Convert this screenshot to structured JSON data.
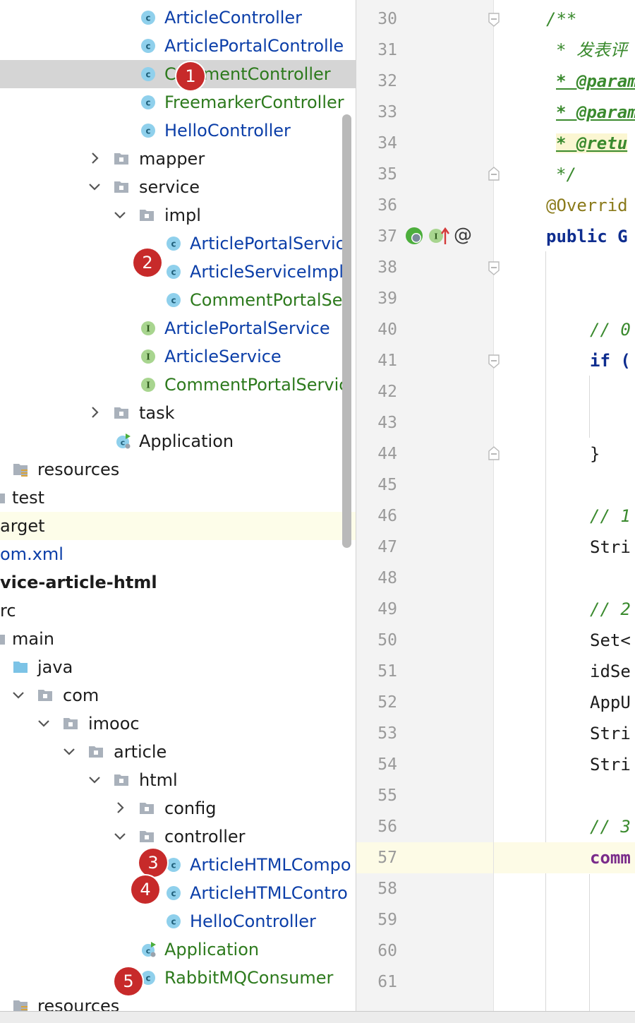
{
  "project_tree": {
    "items": [
      {
        "label": "ArticleController",
        "icon": "class-icon",
        "color": "blue"
      },
      {
        "label": "ArticlePortalControlle",
        "icon": "class-icon",
        "color": "blue"
      },
      {
        "label": "CommentController",
        "icon": "class-icon",
        "color": "green",
        "selected": true
      },
      {
        "label": "FreemarkerController",
        "icon": "class-icon",
        "color": "green"
      },
      {
        "label": "HelloController",
        "icon": "class-icon",
        "color": "blue"
      },
      {
        "label": "mapper",
        "icon": "folder-icon",
        "expanded": false
      },
      {
        "label": "service",
        "icon": "folder-icon",
        "expanded": true
      },
      {
        "label": "impl",
        "icon": "folder-icon",
        "expanded": true
      },
      {
        "label": "ArticlePortalServic",
        "icon": "class-icon",
        "color": "blue"
      },
      {
        "label": "ArticleServiceImpl",
        "icon": "class-icon",
        "color": "blue"
      },
      {
        "label": "CommentPortalSer",
        "icon": "class-icon",
        "color": "green"
      },
      {
        "label": "ArticlePortalService",
        "icon": "interface-icon",
        "color": "blue"
      },
      {
        "label": "ArticleService",
        "icon": "interface-icon",
        "color": "blue"
      },
      {
        "label": "CommentPortalServic",
        "icon": "interface-icon",
        "color": "green"
      },
      {
        "label": "task",
        "icon": "folder-icon",
        "expanded": false
      },
      {
        "label": "Application",
        "icon": "spring-app-icon",
        "color": "black"
      },
      {
        "label": "resources",
        "icon": "resources-folder-icon"
      },
      {
        "label": "test",
        "icon": "folder-icon"
      },
      {
        "label": "arget",
        "icon": "none"
      },
      {
        "label": "om.xml",
        "icon": "none",
        "color": "blue"
      },
      {
        "label": "vice-article-html",
        "icon": "none",
        "bold": true
      },
      {
        "label": "rc",
        "icon": "none"
      },
      {
        "label": "main",
        "icon": "folder-icon"
      },
      {
        "label": "java",
        "icon": "source-folder-icon"
      },
      {
        "label": "com",
        "icon": "folder-icon",
        "expanded": true
      },
      {
        "label": "imooc",
        "icon": "folder-icon",
        "expanded": true
      },
      {
        "label": "article",
        "icon": "folder-icon",
        "expanded": true
      },
      {
        "label": "html",
        "icon": "folder-icon",
        "expanded": true
      },
      {
        "label": "config",
        "icon": "folder-icon",
        "expanded": false
      },
      {
        "label": "controller",
        "icon": "folder-icon",
        "expanded": true
      },
      {
        "label": "ArticleHTMLCompo",
        "icon": "class-icon",
        "color": "blue"
      },
      {
        "label": "ArticleHTMLContro",
        "icon": "class-icon",
        "color": "blue"
      },
      {
        "label": "HelloController",
        "icon": "class-icon",
        "color": "blue"
      },
      {
        "label": "Application",
        "icon": "spring-app-icon",
        "color": "green"
      },
      {
        "label": "RabbitMQConsumer",
        "icon": "class-icon",
        "color": "green"
      },
      {
        "label": "resources",
        "icon": "resources-folder-icon"
      }
    ]
  },
  "annotations": [
    "1",
    "2",
    "3",
    "4",
    "5"
  ],
  "editor": {
    "lines": [
      {
        "n": "30",
        "text": "/**"
      },
      {
        "n": "31",
        "text": "* 发表评"
      },
      {
        "n": "32",
        "text": "* @param"
      },
      {
        "n": "33",
        "text": "* @param"
      },
      {
        "n": "34",
        "text": "* @retu"
      },
      {
        "n": "35",
        "text": "*/"
      },
      {
        "n": "36",
        "text": "@Overrid"
      },
      {
        "n": "37",
        "text": "public G"
      },
      {
        "n": "38",
        "text": ""
      },
      {
        "n": "39",
        "text": ""
      },
      {
        "n": "40",
        "text": "// 0"
      },
      {
        "n": "41",
        "text": "if ("
      },
      {
        "n": "42",
        "text": ""
      },
      {
        "n": "43",
        "text": ""
      },
      {
        "n": "44",
        "text": "}"
      },
      {
        "n": "45",
        "text": ""
      },
      {
        "n": "46",
        "text": "// 1"
      },
      {
        "n": "47",
        "text": "Stri"
      },
      {
        "n": "48",
        "text": ""
      },
      {
        "n": "49",
        "text": "// 2"
      },
      {
        "n": "50",
        "text": "Set<"
      },
      {
        "n": "51",
        "text": "idSe"
      },
      {
        "n": "52",
        "text": "AppU"
      },
      {
        "n": "53",
        "text": "Stri"
      },
      {
        "n": "54",
        "text": "Stri"
      },
      {
        "n": "55",
        "text": ""
      },
      {
        "n": "56",
        "text": "// 3"
      },
      {
        "n": "57",
        "text": "comm"
      },
      {
        "n": "58",
        "text": ""
      },
      {
        "n": "59",
        "text": ""
      },
      {
        "n": "60",
        "text": ""
      },
      {
        "n": "61",
        "text": ""
      }
    ],
    "gutter_icon_at": "@"
  },
  "colors": {
    "blue_text": "#0b3ea8",
    "green_text": "#2d7a1d",
    "selection": "#d5d5d5",
    "badge": "#c72a2a",
    "current_line": "#fdfbe6"
  }
}
